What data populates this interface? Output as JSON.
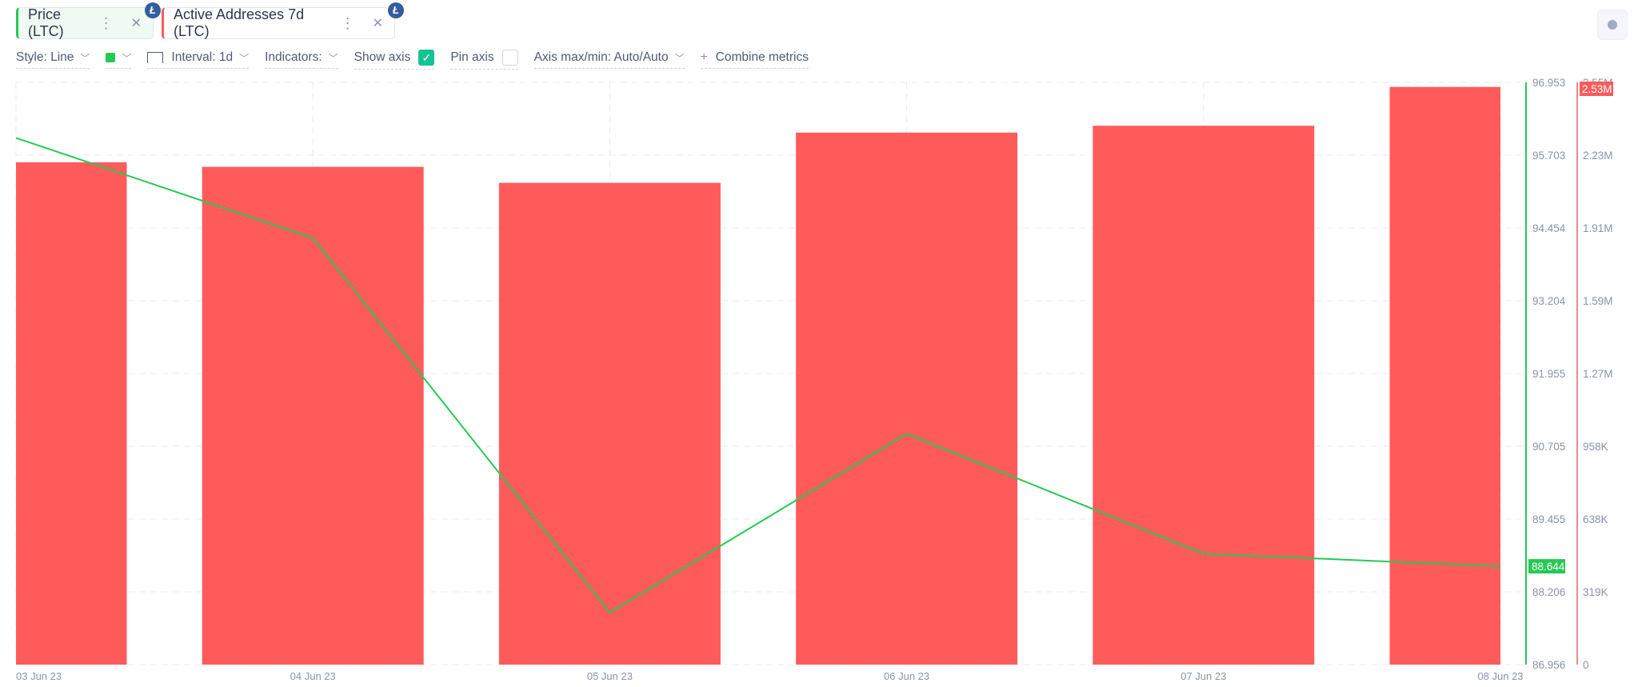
{
  "tabs": [
    {
      "label": "Price (LTC)",
      "color": "#26c953",
      "badge": "Ł"
    },
    {
      "label": "Active Addresses 7d (LTC)",
      "color": "#ff5b5b",
      "badge": "Ł"
    }
  ],
  "toolbar": {
    "style": "Style: Line",
    "interval": "Interval: 1d",
    "indicators": "Indicators:",
    "show_axis": "Show axis",
    "show_axis_checked": true,
    "pin_axis": "Pin axis",
    "pin_axis_checked": false,
    "axis_maxmin": "Axis max/min: Auto/Auto",
    "combine": "Combine metrics",
    "metric_color": "#26c953"
  },
  "chart_data": {
    "type": "bar+line",
    "categories": [
      "03 Jun 23",
      "04 Jun 23",
      "05 Jun 23",
      "06 Jun 23",
      "07 Jun 23",
      "08 Jun 23"
    ],
    "series": [
      {
        "name": "Price (LTC)",
        "type": "line",
        "color": "#26c953",
        "axis": "left-price",
        "values": [
          96.0,
          94.28,
          87.85,
          90.92,
          88.86,
          88.644
        ]
      },
      {
        "name": "Active Addresses 7d (LTC)",
        "type": "bar",
        "color": "#ff5b5b",
        "axis": "right-addresses",
        "values": [
          2200000,
          2180000,
          2110000,
          2330000,
          2360000,
          2530000
        ]
      }
    ],
    "price_axis": {
      "ylim": [
        86.956,
        96.953
      ],
      "ticks": [
        "96.953",
        "95.703",
        "94.454",
        "93.204",
        "91.955",
        "90.705",
        "89.455",
        "88.206",
        "86.956"
      ],
      "last_label": "88.644"
    },
    "addr_axis": {
      "ylim": [
        0,
        2550000
      ],
      "ticks": [
        "2.55M",
        "2.23M",
        "1.91M",
        "1.59M",
        "1.27M",
        "958K",
        "638K",
        "319K",
        "0"
      ],
      "last_label": "2.53M"
    },
    "grid": true
  }
}
